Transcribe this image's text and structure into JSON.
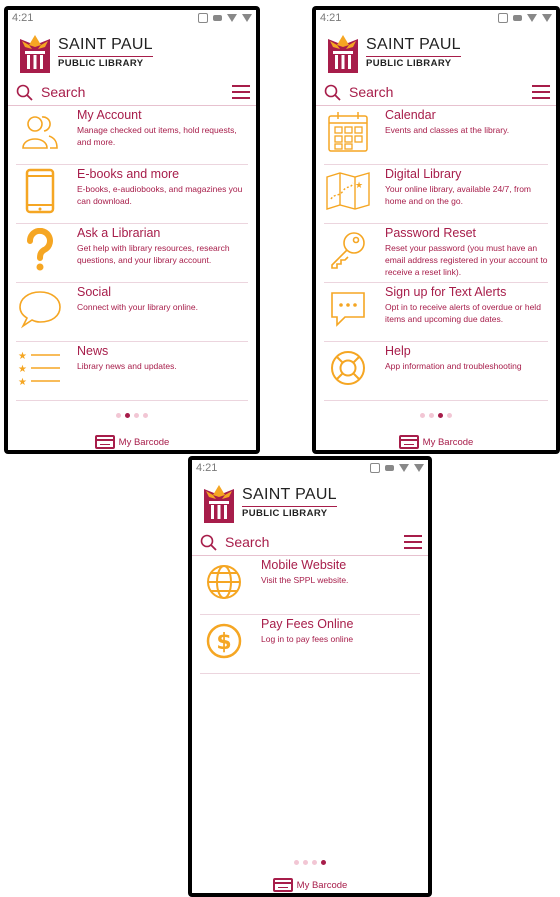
{
  "colors": {
    "accent": "#a71d4a",
    "icon": "#f5a623"
  },
  "screens": [
    {
      "status_time": "4:21",
      "logo": {
        "line1": "SAINT PAUL",
        "line2": "PUBLIC LIBRARY"
      },
      "search_placeholder": "Search",
      "items": [
        {
          "title": "My Account",
          "desc": "Manage checked out items, hold requests, and more.",
          "icon": "users-icon"
        },
        {
          "title": "E-books and more",
          "desc": "E-books, e-audiobooks, and magazines you can download.",
          "icon": "tablet-icon"
        },
        {
          "title": "Ask a Librarian",
          "desc": "Get help with library resources, research questions, and your library account.",
          "icon": "question-icon"
        },
        {
          "title": "Social",
          "desc": "Connect with your library online.",
          "icon": "speech-bubble-icon"
        },
        {
          "title": "News",
          "desc": "Library news and updates.",
          "icon": "star-list-icon"
        }
      ],
      "page_index": 2,
      "barcode_label": "My Barcode"
    },
    {
      "status_time": "4:21",
      "logo": {
        "line1": "SAINT PAUL",
        "line2": "PUBLIC LIBRARY"
      },
      "search_placeholder": "Search",
      "items": [
        {
          "title": "Calendar",
          "desc": "Events and classes at the library.",
          "icon": "calendar-icon"
        },
        {
          "title": "Digital Library",
          "desc": "Your online library, available 24/7, from home and on the go.",
          "icon": "map-icon"
        },
        {
          "title": "Password Reset",
          "desc": "Reset your password (you must have an email address registered in your account to receive a reset link).",
          "icon": "key-icon"
        },
        {
          "title": "Sign up for Text Alerts",
          "desc": "Opt in to receive alerts of overdue or held items and upcoming due dates.",
          "icon": "chat-icon"
        },
        {
          "title": "Help",
          "desc": "App information and troubleshooting",
          "icon": "lifebuoy-icon"
        }
      ],
      "page_index": 3,
      "barcode_label": "My Barcode"
    },
    {
      "status_time": "4:21",
      "logo": {
        "line1": "SAINT PAUL",
        "line2": "PUBLIC LIBRARY"
      },
      "search_placeholder": "Search",
      "items": [
        {
          "title": "Mobile Website",
          "desc": "Visit the SPPL website.",
          "icon": "globe-icon"
        },
        {
          "title": "Pay Fees Online",
          "desc": "Log in to pay fees online",
          "icon": "dollar-icon"
        }
      ],
      "page_index": 4,
      "barcode_label": "My Barcode"
    }
  ]
}
